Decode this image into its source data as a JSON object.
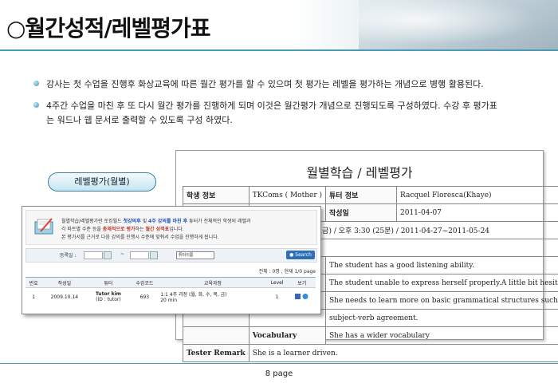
{
  "slide": {
    "title": "○월간성적/레벨평가표",
    "bullets": [
      "강사는 첫 수업을 진행후 화상교육에 따른 월간 평가를 할 수 있으며 첫 평가는 레벨을 평가하는 개념으로 병행 활용된다.",
      "4주간 수업을 마친 후 또 다시 월간 평가를 진행하게 되며 이것은 월간평가 개념으로 진행되도록 구성하였다. 수강 후 평가표",
      "는 워드나 웹 문서로 출력할 수 있도록 구성 하였다."
    ],
    "pill_label": "레벨평가(월별)",
    "page_number": "8 page"
  },
  "form": {
    "title": "월별학습 / 레벨평가",
    "student_label": "학생 정보",
    "student_value": "TKComs ( Mother )",
    "tutor_label": "튜터 정보",
    "tutor_value": "Racquel Floresca(Khaye)",
    "date_label": "작성일",
    "date_value": "2011-04-07",
    "course_value": "수업 / 4주(월,화,수,목,금) / 오후 3:30 (25분) / 2011-04-27~2011-05-24",
    "comment_1": "The student has a good listening ability.",
    "comment_2": "The student unable to express herself properly.A little bit hesitant",
    "comment_3a": "She needs to learn more on basic grammatical structures such as",
    "comment_3b": "subject-verb agreement.",
    "vocab_label": "Vocabulary",
    "vocab_value": "She has a wider vocabulary",
    "remark_label": "Tester Remark",
    "remark_value": "She is a learner driven."
  },
  "panel": {
    "note_1a": "월별학습/레벨평가란 토킹월드 ",
    "note_1b": "첫강의후",
    "note_1c": " 및 ",
    "note_1d": "4주 강의를 마친 후",
    "note_1e": " 튜터가 전체적인 학생의 레벨과",
    "note_2a": "각 파트별 수준 등을 ",
    "note_2b": "총체적으로 평가",
    "note_2c": "하는 ",
    "note_2d": "월간 성적표",
    "note_2e": "입니다.",
    "note_3": "본 평가서를 근거로 다음 강의를 진행시 수준에 맞춰서 수업을 진행하게 됩니다.",
    "search_label": "등록일 :",
    "range_sep": "~",
    "select_value": "튜터이름",
    "search_button": "Search",
    "paging": "전체 : 0명 , 현재 1/0 page",
    "headers": [
      "번호",
      "작성일",
      "튜터",
      "수강코드",
      "교육과정",
      "Level",
      "보기"
    ],
    "row": {
      "no": "1",
      "date": "2009.10.14",
      "tutor_name": "Tutor kim",
      "tutor_id": "(ID : tutor)",
      "code": "693",
      "course_1": "1:1 4주 과정 (월, 화, 수, 목, 금)",
      "course_2": "20 min",
      "level": "1"
    }
  },
  "colors": {
    "accent": "#4a9bb5",
    "link": "#1a4fc0",
    "highlight": "#c0392b",
    "button": "#2f6fb5"
  }
}
